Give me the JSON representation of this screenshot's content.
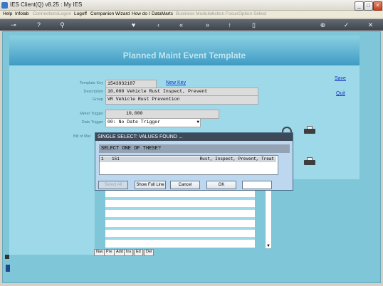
{
  "window": {
    "title": "IES Client(Q) v8.25 : My IES"
  },
  "menu": [
    {
      "label": "Help",
      "enabled": true
    },
    {
      "label": "Infolab",
      "enabled": true
    },
    {
      "label": "Connections",
      "enabled": false
    },
    {
      "label": "Logon",
      "enabled": false
    },
    {
      "label": "Logoff",
      "enabled": true
    },
    {
      "label": "Companion",
      "enabled": true
    },
    {
      "label": "Wizard",
      "enabled": true
    },
    {
      "label": "How do I",
      "enabled": true
    },
    {
      "label": "DataMarts",
      "enabled": true
    },
    {
      "label": "Business Modules",
      "enabled": false
    },
    {
      "label": "Action Focus",
      "enabled": false
    },
    {
      "label": "Option Select",
      "enabled": false
    }
  ],
  "page": {
    "title": "Planned Maint Event Template",
    "save_link": "Save",
    "quit_link": "Quit",
    "new_key_link": "New Key"
  },
  "fields": {
    "template_key": {
      "label": "Template Key",
      "value": "1543932187"
    },
    "description": {
      "label": "Description",
      "value": "10,000 Vehicle Rust Inspect, Prevent"
    },
    "group": {
      "label": "Group",
      "value": "VR Vehicle Rust Prevention"
    },
    "meter_trigger": {
      "label": "Meter Trigger",
      "value": "10,000"
    },
    "date_trigger": {
      "label": "Date Trigger",
      "value": "00: No Date Trigger"
    },
    "bill_of_materials": {
      "label": "Bill of Mat"
    }
  },
  "grid_buttons": [
    "Nav",
    "Pre",
    "Add",
    "Ins",
    "Ed",
    "Del"
  ],
  "dialog": {
    "title": "SINGLE SELECT: VALUES FOUND ...",
    "heading": "SELECT ONE OF THESE?",
    "items": [
      {
        "index": "1",
        "code": "151",
        "text": "Rust, Inspect, Prevent, Treat"
      }
    ],
    "buttons": {
      "select_all": "Select All",
      "show_full_line": "Show Full Line",
      "cancel": "Cancel",
      "ok": "OK"
    }
  }
}
